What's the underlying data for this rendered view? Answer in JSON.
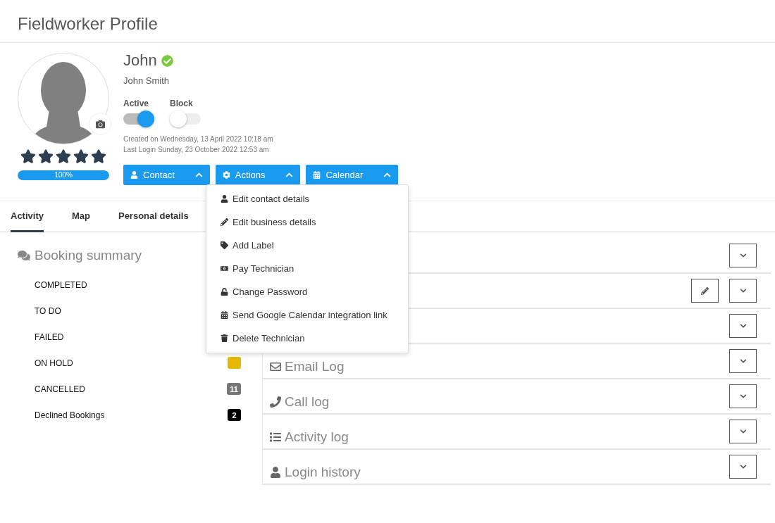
{
  "page_title": "Fieldworker Profile",
  "profile": {
    "first_name": "John",
    "verified": true,
    "full_name": "John Smith",
    "stars": 5,
    "progress": {
      "level": 1,
      "label": "100%"
    },
    "switches": [
      {
        "label": "Active",
        "on": true
      },
      {
        "label": "Block",
        "on": false
      }
    ],
    "created": "Created on Wednesday, 13 April 2022 10:18 am",
    "last_login": "Last Login Sunday, 23 October 2022 12:53 am",
    "buttons": [
      "Contact",
      "Actions",
      "Calendar"
    ]
  },
  "actions_menu": [
    "Edit contact details",
    "Edit business details",
    "Add Label",
    "Pay Technician",
    "Change Password",
    "Send Google Calendar integration link",
    "Delete Technician"
  ],
  "tabs": [
    {
      "label": "Activity",
      "selected": true
    },
    {
      "label": "Map",
      "selected": false
    },
    {
      "label": "Personal details",
      "selected": false
    }
  ],
  "booking_summary": {
    "title": "Booking summary",
    "rows": [
      {
        "label": "COMPLETED"
      },
      {
        "label": "TO DO"
      },
      {
        "label": "FAILED"
      },
      {
        "label": "ON HOLD",
        "badge": {
          "color": "#e8b800"
        }
      },
      {
        "label": "CANCELLED",
        "badge": {
          "text": "11",
          "color": "#777777"
        }
      },
      {
        "label": "Declined Bookings",
        "badge": {
          "text": "2",
          "color": "#000000"
        }
      }
    ]
  },
  "panels": [
    {
      "editable": false
    },
    {
      "editable": true
    },
    {
      "editable": false
    },
    {
      "title": "Email Log",
      "editable": false
    },
    {
      "title": "Call log",
      "editable": false
    },
    {
      "title": "Activity log",
      "editable": false
    },
    {
      "title": "Login history",
      "editable": false
    }
  ]
}
